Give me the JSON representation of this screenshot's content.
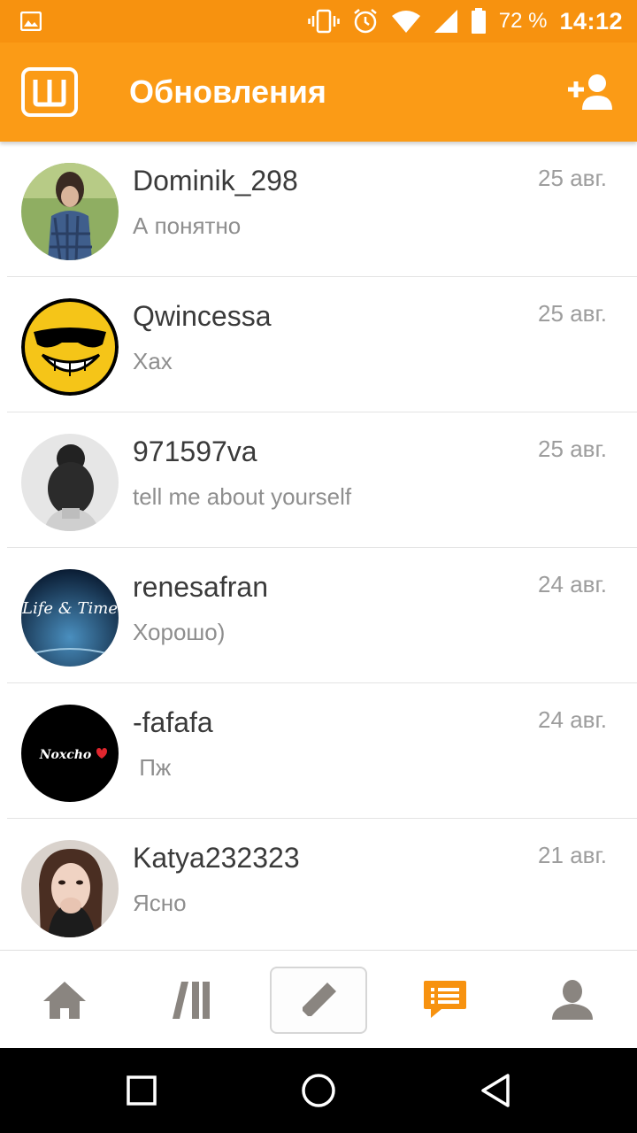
{
  "status_bar": {
    "battery_percent": "72 %",
    "time": "14:12"
  },
  "app_bar": {
    "title": "Обновления",
    "logo_icon": "app-logo-icon",
    "add_friend_icon": "add-user-icon"
  },
  "conversations": [
    {
      "name": "Dominik_298",
      "preview": "А понятно",
      "date": "25 авг."
    },
    {
      "name": "Qwincessa",
      "preview": "Хах",
      "date": "25 авг."
    },
    {
      "name": "971597va",
      "preview": "tell me about yourself",
      "date": "25 авг."
    },
    {
      "name": "renesafran",
      "preview": "Хорошо)",
      "date": "24 авг."
    },
    {
      "name": "-fafafa",
      "preview": " Пж",
      "date": "24 авг."
    },
    {
      "name": "Katya232323",
      "preview": "Ясно",
      "date": "21 авг."
    }
  ],
  "avatar_texts": {
    "renesafran": "Life & Time",
    "fafafa": "Noxcho"
  },
  "bottom_nav": [
    {
      "icon": "home-icon",
      "active": false
    },
    {
      "icon": "library-icon",
      "active": false
    },
    {
      "icon": "pencil-icon",
      "active": false
    },
    {
      "icon": "messages-icon",
      "active": true
    },
    {
      "icon": "profile-icon",
      "active": false
    }
  ],
  "colors": {
    "status_bar": "#f7920f",
    "app_bar": "#fb9b16",
    "active_nav": "#f7920f",
    "inactive_nav": "#8a8580"
  }
}
